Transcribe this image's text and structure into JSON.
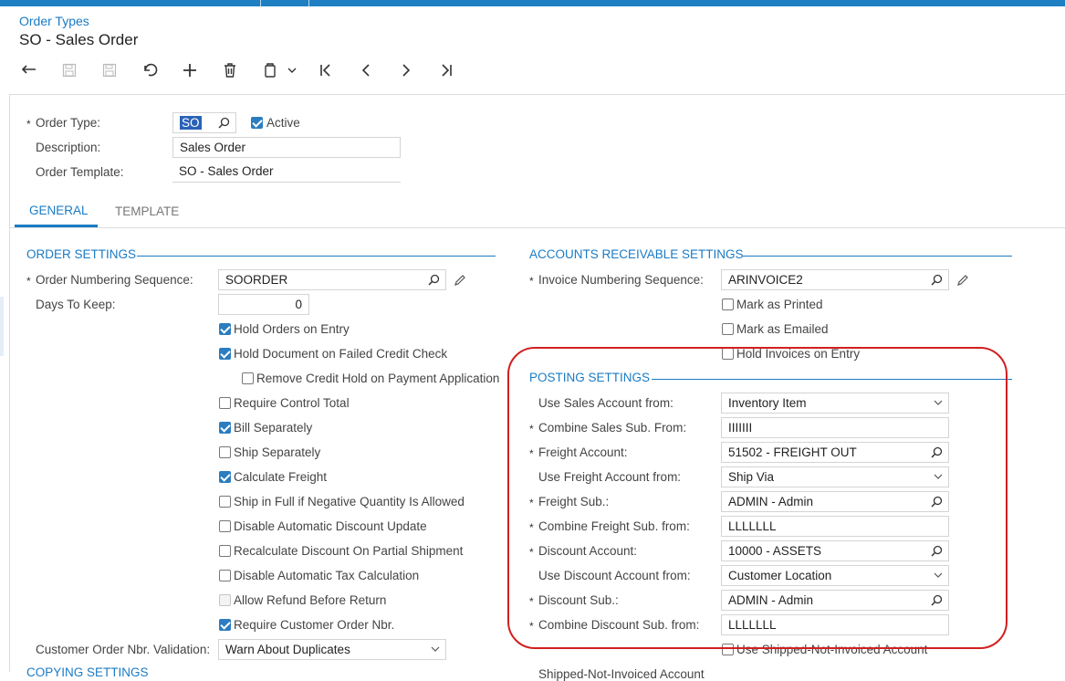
{
  "breadcrumb": "Order Types",
  "page_title": "SO - Sales Order",
  "toolbar": {
    "items": [
      "undo-icon",
      "save-close-icon",
      "save-icon",
      "cancel-icon",
      "add-icon",
      "delete-icon",
      "copy-paste-icon",
      "first-icon",
      "previous-icon",
      "next-icon",
      "last-icon"
    ]
  },
  "header": {
    "order_type_label": "Order Type:",
    "order_type_value": "SO",
    "active_label": "Active",
    "active_checked": true,
    "description_label": "Description:",
    "description_value": "Sales Order",
    "template_label": "Order Template:",
    "template_value": "SO - Sales Order"
  },
  "tabs": [
    "GENERAL",
    "TEMPLATE"
  ],
  "order_settings": {
    "title": "ORDER SETTINGS",
    "numbering_label": "Order Numbering Sequence:",
    "numbering_value": "SOORDER",
    "days_label": "Days To Keep:",
    "days_value": "0",
    "checkboxes": [
      {
        "label": "Hold Orders on Entry",
        "checked": true
      },
      {
        "label": "Hold Document on Failed Credit Check",
        "checked": true
      },
      {
        "label": "Remove Credit Hold on Payment Application",
        "checked": false
      },
      {
        "label": "Require Control Total",
        "checked": false
      },
      {
        "label": "Bill Separately",
        "checked": true
      },
      {
        "label": "Ship Separately",
        "checked": false
      },
      {
        "label": "Calculate Freight",
        "checked": true
      },
      {
        "label": "Ship in Full if Negative Quantity Is Allowed",
        "checked": false
      },
      {
        "label": "Disable Automatic Discount Update",
        "checked": false
      },
      {
        "label": "Recalculate Discount On Partial Shipment",
        "checked": false
      },
      {
        "label": "Disable Automatic Tax Calculation",
        "checked": false
      },
      {
        "label": "Allow Refund Before Return",
        "checked": false
      },
      {
        "label": "Require Customer Order Nbr.",
        "checked": true
      }
    ],
    "validation_label": "Customer Order Nbr. Validation:",
    "validation_value": "Warn About Duplicates",
    "copying_title": "COPYING SETTINGS"
  },
  "ar_settings": {
    "title": "ACCOUNTS RECEIVABLE SETTINGS",
    "invoice_seq_label": "Invoice Numbering Sequence:",
    "invoice_seq_value": "ARINVOICE2",
    "mark_printed": "Mark as Printed",
    "mark_emailed": "Mark as Emailed",
    "hold_invoices": "Hold Invoices on Entry"
  },
  "posting_settings": {
    "title": "POSTING SETTINGS",
    "rows": [
      {
        "label": "Use Sales Account from:",
        "value": "Inventory Item",
        "required": false,
        "kind": "select"
      },
      {
        "label": "Combine Sales Sub. From:",
        "value": "IIIIIII",
        "required": true,
        "kind": "text"
      },
      {
        "label": "Freight Account:",
        "value": "51502 - FREIGHT OUT",
        "required": true,
        "kind": "lookup"
      },
      {
        "label": "Use Freight Account from:",
        "value": "Ship Via",
        "required": false,
        "kind": "select"
      },
      {
        "label": "Freight Sub.:",
        "value": "ADMIN - Admin",
        "required": true,
        "kind": "lookup"
      },
      {
        "label": "Combine Freight Sub. from:",
        "value": "LLLLLLL",
        "required": true,
        "kind": "text"
      },
      {
        "label": "Discount Account:",
        "value": "10000 - ASSETS",
        "required": true,
        "kind": "lookup"
      },
      {
        "label": "Use Discount Account from:",
        "value": "Customer Location",
        "required": false,
        "kind": "select"
      },
      {
        "label": "Discount Sub.:",
        "value": "ADMIN - Admin",
        "required": true,
        "kind": "lookup"
      },
      {
        "label": "Combine Discount Sub. from:",
        "value": "LLLLLLL",
        "required": true,
        "kind": "text"
      }
    ],
    "use_shipped_label": "Use Shipped-Not-Invoiced Account",
    "shipped_account_label": "Shipped-Not-Invoiced Account"
  },
  "colors": {
    "accent": "#1a7bc4",
    "topbar": "#1e7fc2",
    "highlight": "#d21f1f",
    "checkbox": "#2b7dc0"
  }
}
